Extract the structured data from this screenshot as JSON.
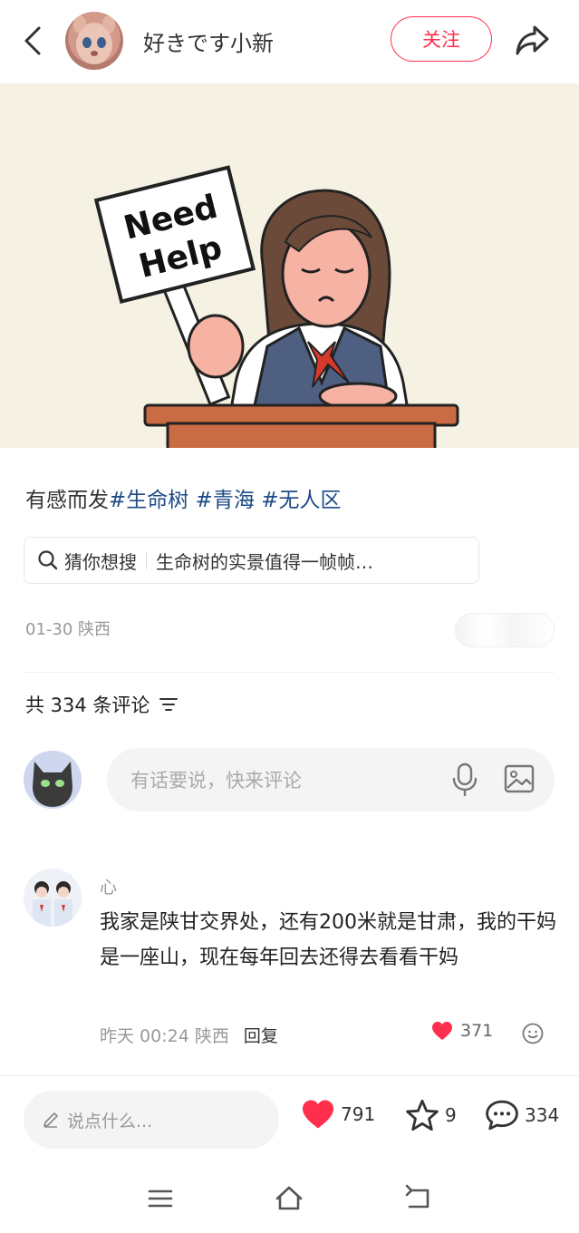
{
  "header": {
    "username": "好きです小新",
    "follow_label": "关注"
  },
  "post": {
    "image_sign_text": "Need Help",
    "caption_plain": "有感而发",
    "tags": [
      "#生命树",
      "#青海",
      "#无人区"
    ],
    "suggest_label": "猜你想搜",
    "suggest_text": "生命树的实景值得一帧帧…",
    "date": "01-30",
    "location": "陕西"
  },
  "comments_section": {
    "count_label": "共 334 条评论",
    "input_placeholder": "有话要说，快来评论"
  },
  "comment": {
    "name": "心",
    "text": "我家是陕甘交界处，还有200米就是甘肃，我的干妈是一座山，现在每年回去还得去看看干妈",
    "time": "昨天 00:24",
    "location": "陕西",
    "reply_label": "回复",
    "likes": "371"
  },
  "bottom_bar": {
    "input_placeholder": "说点什么...",
    "likes": "791",
    "favorites": "9",
    "comments": "334"
  },
  "colors": {
    "accent": "#ff2e4d",
    "tag": "#1d4b86"
  }
}
